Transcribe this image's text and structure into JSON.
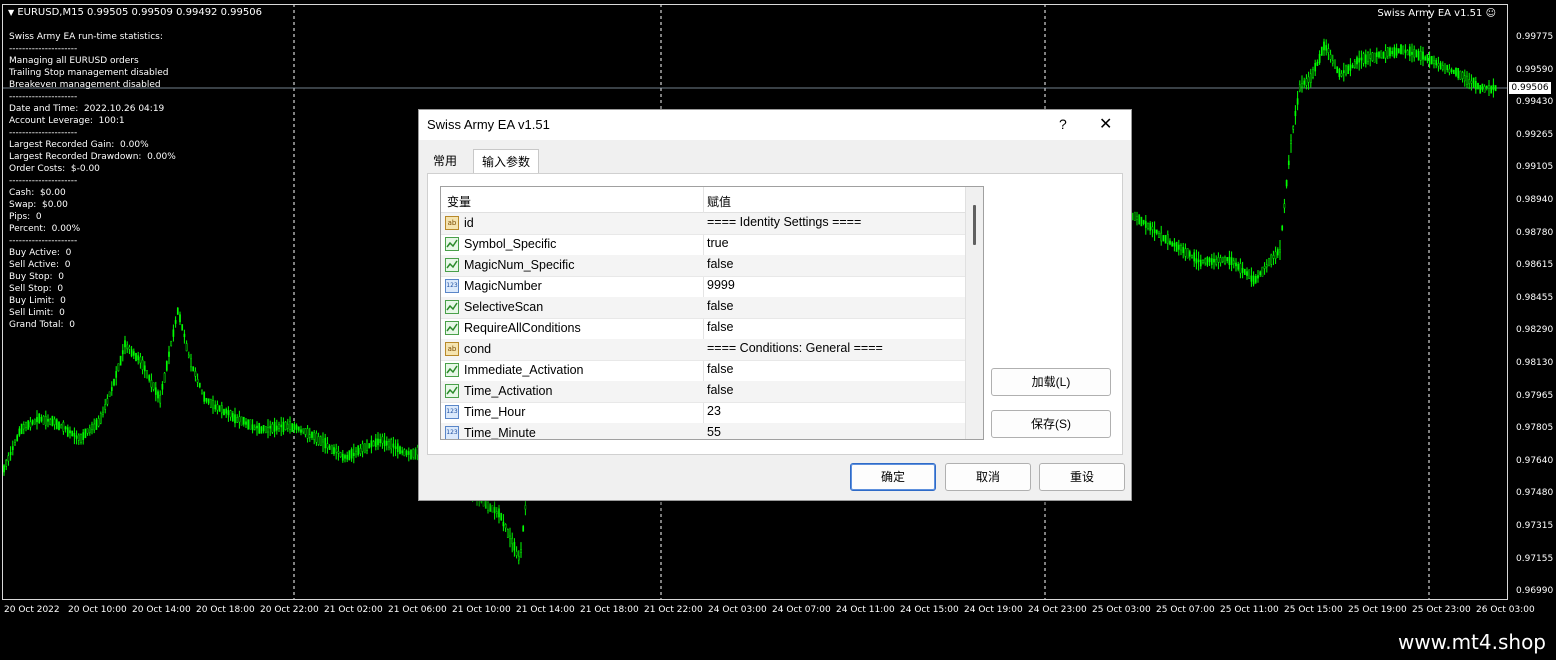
{
  "chart": {
    "ticker_line": "EURUSD,M15  0.99505 0.99509 0.99492 0.99506",
    "ea_label": "Swiss Army EA v1.51",
    "current_price": "0.99506",
    "colors": {
      "background": "#000000",
      "candles": "#00ff00",
      "grid": "#ffffff",
      "text": "#ffffff"
    },
    "stats_lines": [
      "Swiss Army EA run-time statistics:",
      "---------------------",
      "Managing all EURUSD orders",
      "Trailing Stop management disabled",
      "Breakeven management disabled",
      "---------------------",
      "Date and Time:  2022.10.26 04:19",
      "Account Leverage:  100:1",
      "---------------------",
      "Largest Recorded Gain:  0.00%",
      "Largest Recorded Drawdown:  0.00%",
      "Order Costs:  $-0.00",
      "---------------------",
      "Cash:  $0.00",
      "Swap:  $0.00",
      "Pips:  0",
      "Percent:  0.00%",
      "---------------------",
      "Buy Active:  0",
      "Sell Active:  0",
      "Buy Stop:  0",
      "Sell Stop:  0",
      "Buy Limit:  0",
      "Sell Limit:  0",
      "Grand Total:  0"
    ],
    "price_labels": [
      "0.99775",
      "0.99590",
      "0.99430",
      "0.99265",
      "0.99105",
      "0.98940",
      "0.98780",
      "0.98615",
      "0.98455",
      "0.98290",
      "0.98130",
      "0.97965",
      "0.97805",
      "0.97640",
      "0.97480",
      "0.97315",
      "0.97155",
      "0.96990"
    ],
    "time_labels": [
      "20 Oct 2022",
      "20 Oct 10:00",
      "20 Oct 14:00",
      "20 Oct 18:00",
      "20 Oct 22:00",
      "21 Oct 02:00",
      "21 Oct 06:00",
      "21 Oct 10:00",
      "21 Oct 14:00",
      "21 Oct 18:00",
      "21 Oct 22:00",
      "24 Oct 03:00",
      "24 Oct 07:00",
      "24 Oct 11:00",
      "24 Oct 15:00",
      "24 Oct 19:00",
      "24 Oct 23:00",
      "25 Oct 03:00",
      "25 Oct 07:00",
      "25 Oct 11:00",
      "25 Oct 15:00",
      "25 Oct 19:00",
      "25 Oct 23:00",
      "26 Oct 03:00"
    ]
  },
  "dialog": {
    "title": "Swiss Army EA v1.51",
    "help": "?",
    "close": "✕",
    "tabs": [
      "常用",
      "输入参数"
    ],
    "columns": [
      "变量",
      "赋值"
    ],
    "rows": [
      {
        "icon": "ab",
        "name": "id",
        "value": "==== Identity Settings ===="
      },
      {
        "icon": "tf",
        "name": "Symbol_Specific",
        "value": "true"
      },
      {
        "icon": "tf",
        "name": "MagicNum_Specific",
        "value": "false"
      },
      {
        "icon": "123",
        "name": "MagicNumber",
        "value": "9999"
      },
      {
        "icon": "tf",
        "name": "SelectiveScan",
        "value": "false"
      },
      {
        "icon": "tf",
        "name": "RequireAllConditions",
        "value": "false"
      },
      {
        "icon": "ab",
        "name": "cond",
        "value": "==== Conditions: General ===="
      },
      {
        "icon": "tf",
        "name": "Immediate_Activation",
        "value": "false"
      },
      {
        "icon": "tf",
        "name": "Time_Activation",
        "value": "false"
      },
      {
        "icon": "123",
        "name": "Time_Hour",
        "value": "23"
      },
      {
        "icon": "123",
        "name": "Time_Minute",
        "value": "55"
      }
    ],
    "load_button": "加载(L)",
    "save_button": "保存(S)",
    "ok_button": "确定",
    "cancel_button": "取消",
    "reset_button": "重设"
  },
  "footer": {
    "watermark": "www.mt4.shop"
  }
}
